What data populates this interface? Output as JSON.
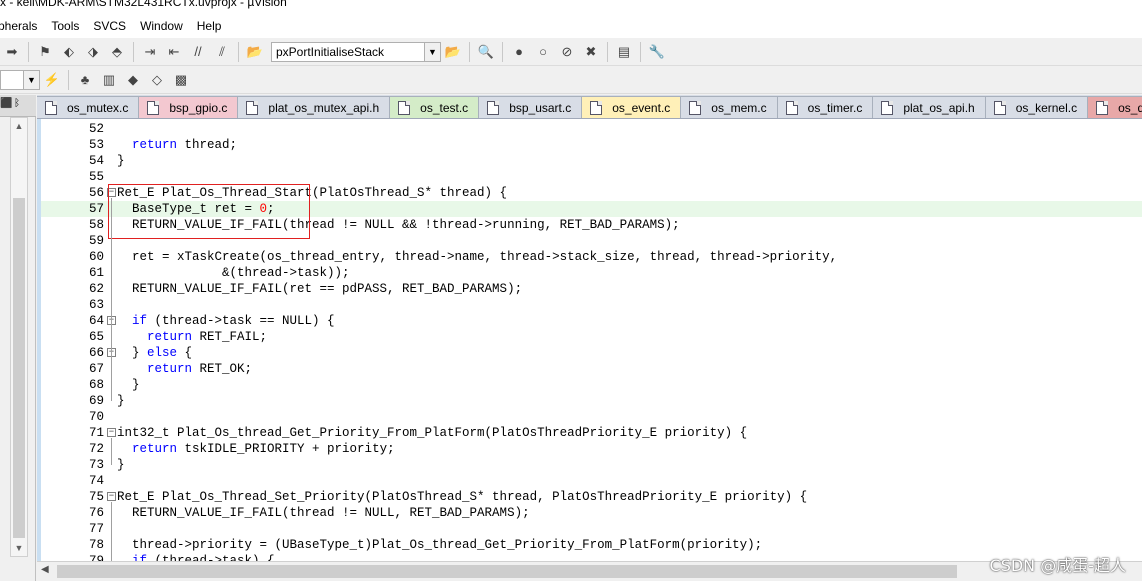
{
  "window": {
    "title": "x - keil\\MDK-ARM\\STM32L431RCTx.uvprojx - µVision"
  },
  "menu": [
    "pherals",
    "Tools",
    "SVCS",
    "Window",
    "Help"
  ],
  "toolbar": {
    "function_combo": "pxPortInitialiseStack",
    "icons1": [
      "arrow-right-icon",
      "flag-icon",
      "bookmark-prev-icon",
      "bookmark-next-icon",
      "bookmark-clear-icon",
      "indent-icon",
      "unindent-icon",
      "comment-icon",
      "uncomment-icon",
      "open-file-icon"
    ],
    "icons2": [
      "find-icon",
      "insert-breakpoint-icon",
      "enable-breakpoint-icon",
      "disable-breakpoint-icon",
      "kill-breakpoint-icon",
      "window-layout-icon",
      "settings-wrench-icon"
    ]
  },
  "tabs": [
    {
      "label": "os_mutex.c",
      "color": "#d8dde6"
    },
    {
      "label": "bsp_gpio.c",
      "color": "#f3c8d0"
    },
    {
      "label": "plat_os_mutex_api.h",
      "color": "#d8dde6"
    },
    {
      "label": "os_test.c",
      "color": "#d4ecc8"
    },
    {
      "label": "bsp_usart.c",
      "color": "#d8dde6"
    },
    {
      "label": "os_event.c",
      "color": "#fff0b8"
    },
    {
      "label": "os_mem.c",
      "color": "#d8dde6"
    },
    {
      "label": "os_timer.c",
      "color": "#d8dde6"
    },
    {
      "label": "plat_os_api.h",
      "color": "#d8dde6"
    },
    {
      "label": "os_kernel.c",
      "color": "#d8dde6"
    },
    {
      "label": "os_qu",
      "color": "#e8a8a8"
    }
  ],
  "code": [
    {
      "n": "52",
      "t": ""
    },
    {
      "n": "53",
      "t": "  @return@ thread;"
    },
    {
      "n": "54",
      "t": "}"
    },
    {
      "n": "55",
      "t": ""
    },
    {
      "n": "56",
      "t": "Ret_E Plat_Os_Thread_Start(PlatOsThread_S* thread) {",
      "fold": true
    },
    {
      "n": "57",
      "t": "  BaseType_t ret = #0#;",
      "hl": true
    },
    {
      "n": "58",
      "t": "  RETURN_VALUE_IF_FAIL(thread != NULL && !thread->running, RET_BAD_PARAMS);"
    },
    {
      "n": "59",
      "t": ""
    },
    {
      "n": "60",
      "t": "  ret = xTaskCreate(os_thread_entry, thread->name, thread->stack_size, thread, thread->priority,"
    },
    {
      "n": "61",
      "t": "              &(thread->task));"
    },
    {
      "n": "62",
      "t": "  RETURN_VALUE_IF_FAIL(ret == pdPASS, RET_BAD_PARAMS);"
    },
    {
      "n": "63",
      "t": ""
    },
    {
      "n": "64",
      "t": "  @if@ (thread->task == NULL) {",
      "fold": true
    },
    {
      "n": "65",
      "t": "    @return@ RET_FAIL;"
    },
    {
      "n": "66",
      "t": "  } @else@ {",
      "fold": true
    },
    {
      "n": "67",
      "t": "    @return@ RET_OK;"
    },
    {
      "n": "68",
      "t": "  }"
    },
    {
      "n": "69",
      "t": "}"
    },
    {
      "n": "70",
      "t": ""
    },
    {
      "n": "71",
      "t": "int32_t Plat_Os_thread_Get_Priority_From_PlatForm(PlatOsThreadPriority_E priority) {",
      "fold": true
    },
    {
      "n": "72",
      "t": "  @return@ tskIDLE_PRIORITY + priority;"
    },
    {
      "n": "73",
      "t": "}"
    },
    {
      "n": "74",
      "t": ""
    },
    {
      "n": "75",
      "t": "Ret_E Plat_Os_Thread_Set_Priority(PlatOsThread_S* thread, PlatOsThreadPriority_E priority) {",
      "fold": true
    },
    {
      "n": "76",
      "t": "  RETURN_VALUE_IF_FAIL(thread != NULL, RET_BAD_PARAMS);"
    },
    {
      "n": "77",
      "t": ""
    },
    {
      "n": "78",
      "t": "  thread->priority = (UBaseType_t)Plat_Os_thread_Get_Priority_From_PlatForm(priority);"
    },
    {
      "n": "79",
      "t": "  @if@ (thread->task) {"
    }
  ],
  "watermark": "CSDN @咸蛋-超人"
}
